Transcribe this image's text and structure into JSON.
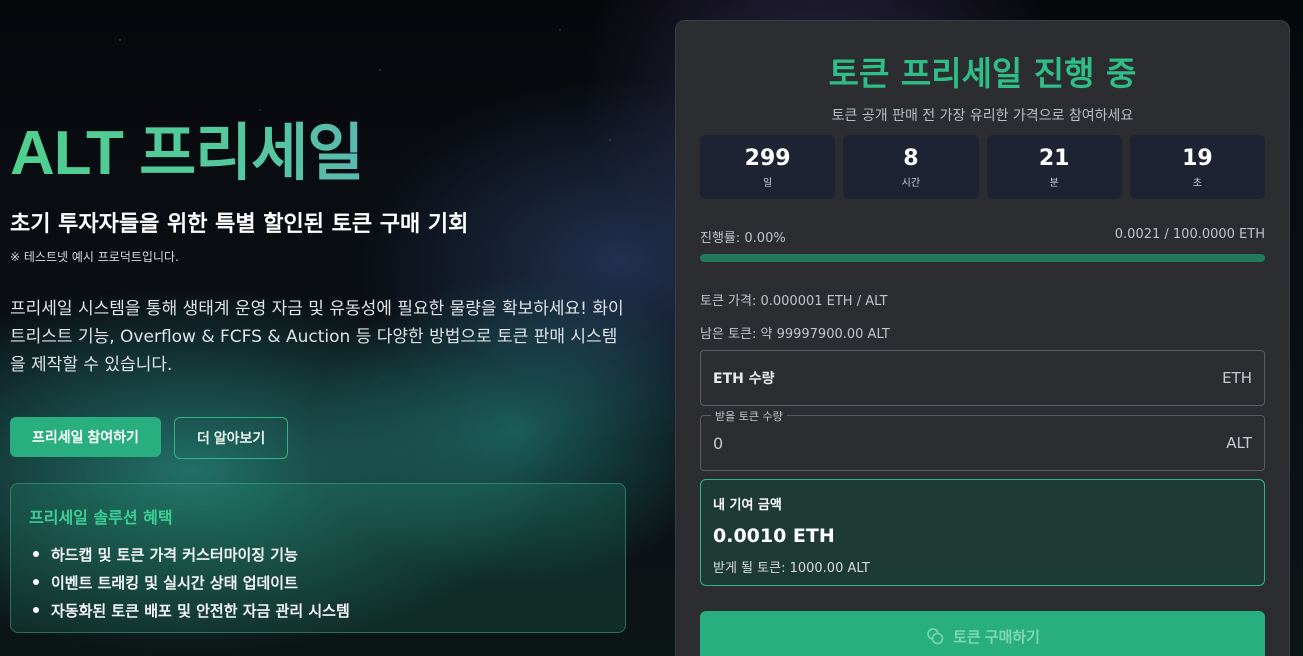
{
  "hero": {
    "title": "ALT 프리세일",
    "subtitle": "초기 투자자들을 위한 특별 할인된 토큰 구매 기회",
    "note": "※ 테스트넷 예시 프로덕트입니다.",
    "description": "프리세일 시스템을 통해 생태계 운영 자금 및 유동성에 필요한 물량을 확보하세요! 화이트리스트 기능, Overflow & FCFS & Auction 등 다양한 방법으로 토큰 판매 시스템을 제작할 수 있습니다.",
    "primary_button": "프리세일 참여하기",
    "secondary_button": "더 알아보기"
  },
  "benefits": {
    "title": "프리세일 솔루션 혜택",
    "items": [
      "하드캡 및 토큰 가격 커스터마이징 기능",
      "이벤트 트래킹 및 실시간 상태 업데이트",
      "자동화된 토큰 배포 및 안전한 자금 관리 시스템"
    ]
  },
  "panel": {
    "title": "토큰 프리세일 진행 중",
    "subtitle": "토큰 공개 판매 전 가장 유리한 가격으로 참여하세요",
    "countdown": [
      {
        "value": "299",
        "unit": "일"
      },
      {
        "value": "8",
        "unit": "시간"
      },
      {
        "value": "21",
        "unit": "분"
      },
      {
        "value": "19",
        "unit": "초"
      }
    ],
    "progress_label": "진행률: 0.00%",
    "progress_amount": "0.0021 / 100.0000 ETH",
    "progress_fraction": 0.0,
    "price_line": "토큰 가격: 0.000001 ETH / ALT",
    "remaining_line": "남은 토큰: 약 99997900.00 ALT",
    "eth_field": {
      "label": "ETH 수량",
      "unit": "ETH"
    },
    "token_field": {
      "legend": "받을 토큰 수량",
      "value": "0",
      "unit": "ALT"
    },
    "contribution": {
      "label": "내 기여 금액",
      "amount": "0.0010 ETH",
      "receive": "받게 될 토큰: 1000.00 ALT"
    },
    "buy_button": "토큰 구매하기"
  },
  "colors": {
    "accent": "#28ae7f",
    "accent_text": "#2fbf86",
    "panel_bg": "#2b2d30",
    "countdown_bg": "#1d2333"
  }
}
